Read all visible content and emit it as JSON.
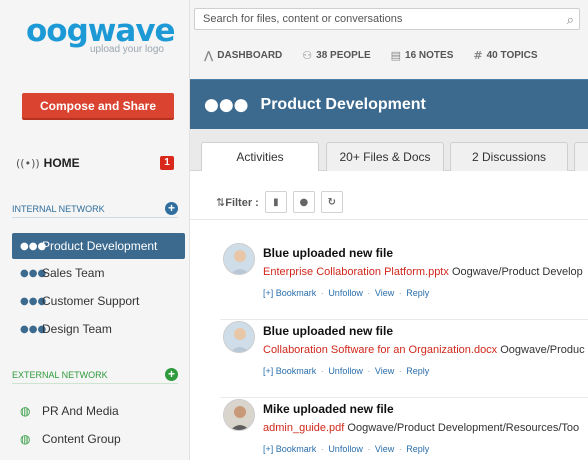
{
  "logo": {
    "name": "oogwave",
    "tagline": "upload your logo"
  },
  "compose_label": "Compose and Share",
  "home": {
    "label": "HOME",
    "badge": "1"
  },
  "internal_network": {
    "title": "INTERNAL NETWORK",
    "items": [
      {
        "label": "Product Development"
      },
      {
        "label": "Sales Team"
      },
      {
        "label": "Customer Support"
      },
      {
        "label": "Design Team"
      }
    ]
  },
  "external_network": {
    "title": "EXTERNAL NETWORK",
    "items": [
      {
        "label": "PR And Media"
      },
      {
        "label": "Content Group"
      }
    ]
  },
  "search": {
    "placeholder": "Search for files, content or conversations"
  },
  "topnav": [
    {
      "label": "DASHBOARD",
      "icon": "chart-icon"
    },
    {
      "label": "38 PEOPLE",
      "icon": "people-icon"
    },
    {
      "label": "16 NOTES",
      "icon": "notes-icon"
    },
    {
      "label": "40 TOPICS",
      "icon": "hash-icon"
    }
  ],
  "group": {
    "title": "Product Development"
  },
  "tabs": [
    {
      "label": "Activities"
    },
    {
      "label": "20+ Files & Docs"
    },
    {
      "label": "2 Discussions"
    }
  ],
  "filter_label": "Filter :",
  "posts": [
    {
      "title": "Blue uploaded new file",
      "file": "Enterprise Collaboration Platform.pptx",
      "path": "Oogwave/Product Develop"
    },
    {
      "title": "Blue uploaded new file",
      "file": "Collaboration Software for an Organization.docx",
      "path": "Oogwave/Produc"
    },
    {
      "title": "Mike uploaded new file",
      "file": "admin_guide.pdf",
      "path": "Oogwave/Product Development/Resources/Too"
    }
  ],
  "post_actions": {
    "bookmark": "[+] Bookmark",
    "unfollow": "Unfollow",
    "view": "View",
    "reply": "Reply",
    "sep": "·"
  },
  "colors": {
    "brand": "#1d9ad6",
    "primary": "#3c6a8f",
    "compose": "#d9432f",
    "file_link": "#d0281c",
    "external": "#2e9a3c"
  }
}
